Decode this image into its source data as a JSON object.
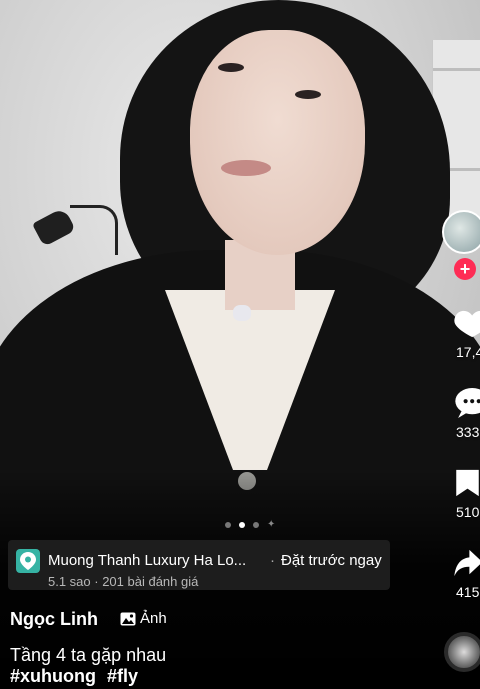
{
  "location": {
    "name": "Muong Thanh Luxury Ha Lo...",
    "separator": "·",
    "cta": "Đặt trước ngay",
    "meta": "5.1 sao · 201 bài đánh giá",
    "pin_color": "#36b3a4"
  },
  "carousel": {
    "page_count": 3,
    "active_index": 1
  },
  "actions": {
    "like_count": "17,4",
    "comment_count": "333",
    "save_count": "510",
    "share_count": "415"
  },
  "post": {
    "username": "Ngọc Linh",
    "badge_icon": "image-icon",
    "badge_label": "Ảnh",
    "caption": "Tầng 4 ta gặp nhau",
    "hashtags": [
      "#xuhuong",
      "#fly"
    ]
  },
  "colors": {
    "follow": "#fe2c55",
    "background": "#000000"
  }
}
